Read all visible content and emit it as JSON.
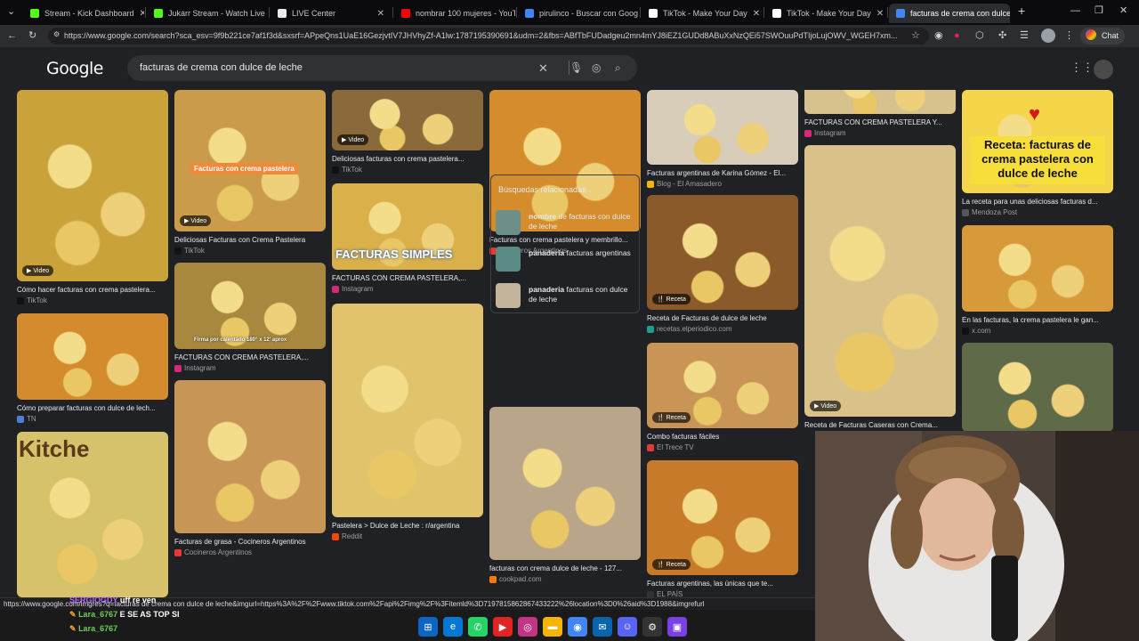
{
  "tabs": [
    {
      "title": "Stream - Kick Dashboard",
      "favicon_color": "#53fc18"
    },
    {
      "title": "Jukarr Stream - Watch Live",
      "favicon_color": "#53fc18"
    },
    {
      "title": "LIVE Center",
      "favicon_color": "#e8eaed"
    },
    {
      "title": "nombrar 100 mujeres - YouT",
      "favicon_color": "#ff0000"
    },
    {
      "title": "pirulinco - Buscar con Goog",
      "favicon_color": "#4285f4"
    },
    {
      "title": "TikTok - Make Your Day",
      "favicon_color": "#ffffff"
    },
    {
      "title": "TikTok - Make Your Day",
      "favicon_color": "#ffffff"
    },
    {
      "title": "facturas de crema con dulce",
      "favicon_color": "#4285f4"
    }
  ],
  "address": {
    "url": "https://www.google.com/search?sca_esv=9f9b221ce7af1f3d&sxsrf=APpeQns1UaE16GezjvtIV7JHVhyZf-A1lw:1787195390691&udm=2&fbs=ABfTbFUDadgeu2mn4mYJ8iEZ1GUDd8ABuXxNzQEi57SWOuuPdTIjoLujOWV_WGEH7xm...",
    "chat_label": "Chat"
  },
  "google": {
    "logo": "Google",
    "query": "facturas de crema con dulce de leche"
  },
  "results": {
    "col1": [
      {
        "caption": "Cómo hacer facturas con crema pastelera...",
        "source": "TikTok",
        "badge": "Video",
        "color": "#c9a23a",
        "src_color": "#111"
      },
      {
        "caption": "Cómo preparar facturas con dulce de lech...",
        "source": "TN",
        "badge": "",
        "color": "#d38b2e",
        "src_color": "#4a7fd4"
      },
      {
        "caption": "",
        "source": "",
        "badge": "",
        "overlay": "Kitche",
        "color": "#d6c26a",
        "src_color": "#888"
      }
    ],
    "col2": [
      {
        "caption": "Deliciosas Facturas con Crema Pastelera",
        "source": "TikTok",
        "badge": "Video",
        "overlay": "Facturas con crema pastelera",
        "color": "#c99b4a",
        "src_color": "#111"
      },
      {
        "caption": "FACTURAS CON CREMA PASTELERA,...",
        "source": "Instagram",
        "badge": "",
        "overlay": "Firma por calentado 180° x 12' aprox",
        "color": "#a8883e",
        "src_color": "#d62976"
      },
      {
        "caption": "Facturas de grasa - Cocineros Argentinos",
        "source": "Cocineros Argentinos",
        "badge": "",
        "color": "#c79555",
        "src_color": "#e53935"
      }
    ],
    "col3": [
      {
        "caption": "Deliciosas facturas con crema pastelera...",
        "source": "TikTok",
        "badge": "Video",
        "color": "#8a6a3b",
        "src_color": "#111"
      },
      {
        "caption": "FACTURAS CON CREMA PASTELERA,...",
        "source": "Instagram",
        "badge": "",
        "overlay": "FACTURAS SIMPLES",
        "color": "#d9b04a",
        "src_color": "#d62976"
      },
      {
        "caption": "Pastelera > Dulce de Leche : r/argentina",
        "source": "Reddit",
        "badge": "",
        "color": "#e0c36a",
        "src_color": "#ff4500"
      }
    ],
    "col4": [
      {
        "caption": "Facturas con crema pastelera y membrillo...",
        "source": "Cocineros Argentinos",
        "badge": "",
        "color": "#d48c2c",
        "src_color": "#e53935"
      },
      {
        "caption": "facturas con crema dulce de leche - 127...",
        "source": "cookpad.com",
        "badge": "",
        "color": "#b9a58a",
        "src_color": "#f57c00"
      }
    ],
    "col5": [
      {
        "caption": "Facturas argentinas de Karina Gómez - El...",
        "source": "Blog - El Amasadero",
        "badge": "",
        "color": "#d8cdb9",
        "src_color": "#f4b400"
      },
      {
        "caption": "Receta de Facturas de dulce de leche",
        "source": "recetas.elperiodico.com",
        "badge": "Receta",
        "color": "#8b5a2b",
        "src_color": "#1a9e8f"
      },
      {
        "caption": "Combo facturas fáciles",
        "source": "El Trece TV",
        "badge": "Receta",
        "color": "#c99556",
        "src_color": "#e53935"
      },
      {
        "caption": "Facturas argentinas, las únicas que te...",
        "source": "EL PAÍS",
        "badge": "Receta",
        "color": "#c67a2a",
        "src_color": "#333"
      }
    ],
    "col6": [
      {
        "caption": "FACTURAS CON CREMA PASTELERA Y...",
        "source": "Instagram",
        "badge": "",
        "color": "#d7c28e",
        "src_color": "#d62976"
      },
      {
        "caption": "Receta de Facturas Caseras con Crema...",
        "source": "",
        "badge": "Video",
        "color": "#d9c28a",
        "src_color": "#111"
      }
    ],
    "col7": [
      {
        "caption": "La receta para unas deliciosas facturas d...",
        "source": "Mendoza Post",
        "badge": "",
        "overlay": "Receta: facturas de crema pastelera con dulce de leche",
        "color": "#f5d54a",
        "src_color": "#555"
      },
      {
        "caption": "En las facturas, la crema pastelera le gan...",
        "source": "x.com",
        "badge": "",
        "color": "#d79a3a",
        "src_color": "#111"
      },
      {
        "caption": "",
        "source": "",
        "badge": "",
        "color": "#5f6b48",
        "src_color": "#111"
      }
    ]
  },
  "related": {
    "heading": "Búsquedas relacionadas",
    "items": [
      {
        "bold": "nombre",
        "rest": " de facturas con dulce de leche",
        "color": "#6d8f8a"
      },
      {
        "bold": "panaderia",
        "rest": " facturas argentinas",
        "color": "#5b8b85"
      },
      {
        "bold": "panaderia",
        "rest": " facturas con dulce de leche",
        "color": "#c2b49a"
      }
    ]
  },
  "statusbar": {
    "url": "https://www.google.com/imgres?q=facturas de crema con dulce de leche&imgurl=https%3A%2F%2Fwww.tiktok.com%2Fapi%2Fimg%2F%3Fitemld%3D7197815862867433222%26location%3D0%26aid%3D1988&imgrefurl"
  },
  "chat": {
    "lines": [
      {
        "user": "SERGIOGDY",
        "msg": "uff re ven",
        "color": "#b26bff"
      },
      {
        "user": "Lara_6767",
        "msg": "E SE AS TOP SI",
        "color": "#6fcf5a"
      },
      {
        "user": "Lara_6767",
        "msg": "",
        "color": "#6fcf5a"
      }
    ]
  }
}
